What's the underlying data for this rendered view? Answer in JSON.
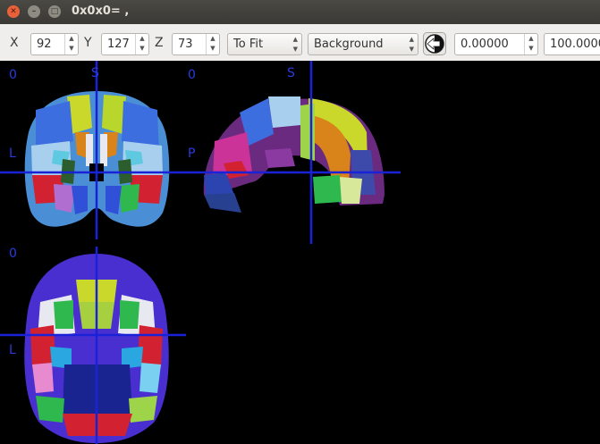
{
  "window": {
    "title": "0x0x0= ,"
  },
  "toolbar": {
    "x_label": "X",
    "x_value": "92",
    "y_label": "Y",
    "y_value": "127",
    "z_label": "Z",
    "z_value": "73",
    "zoom_value": "To Fit",
    "layer_value": "Background",
    "min_value": "0.00000",
    "max_value": "100.0000"
  },
  "viewer": {
    "axial_top": {
      "corner": "0",
      "top_marker": "S",
      "left_marker": "L"
    },
    "sagittal": {
      "corner": "0",
      "top_marker": "S",
      "left_marker": "P"
    },
    "axial_bottom": {
      "corner": "0",
      "left_marker": "L"
    }
  },
  "colors": {
    "crosshair": "#1a22d8",
    "overlay_text": "#2a3be0"
  }
}
